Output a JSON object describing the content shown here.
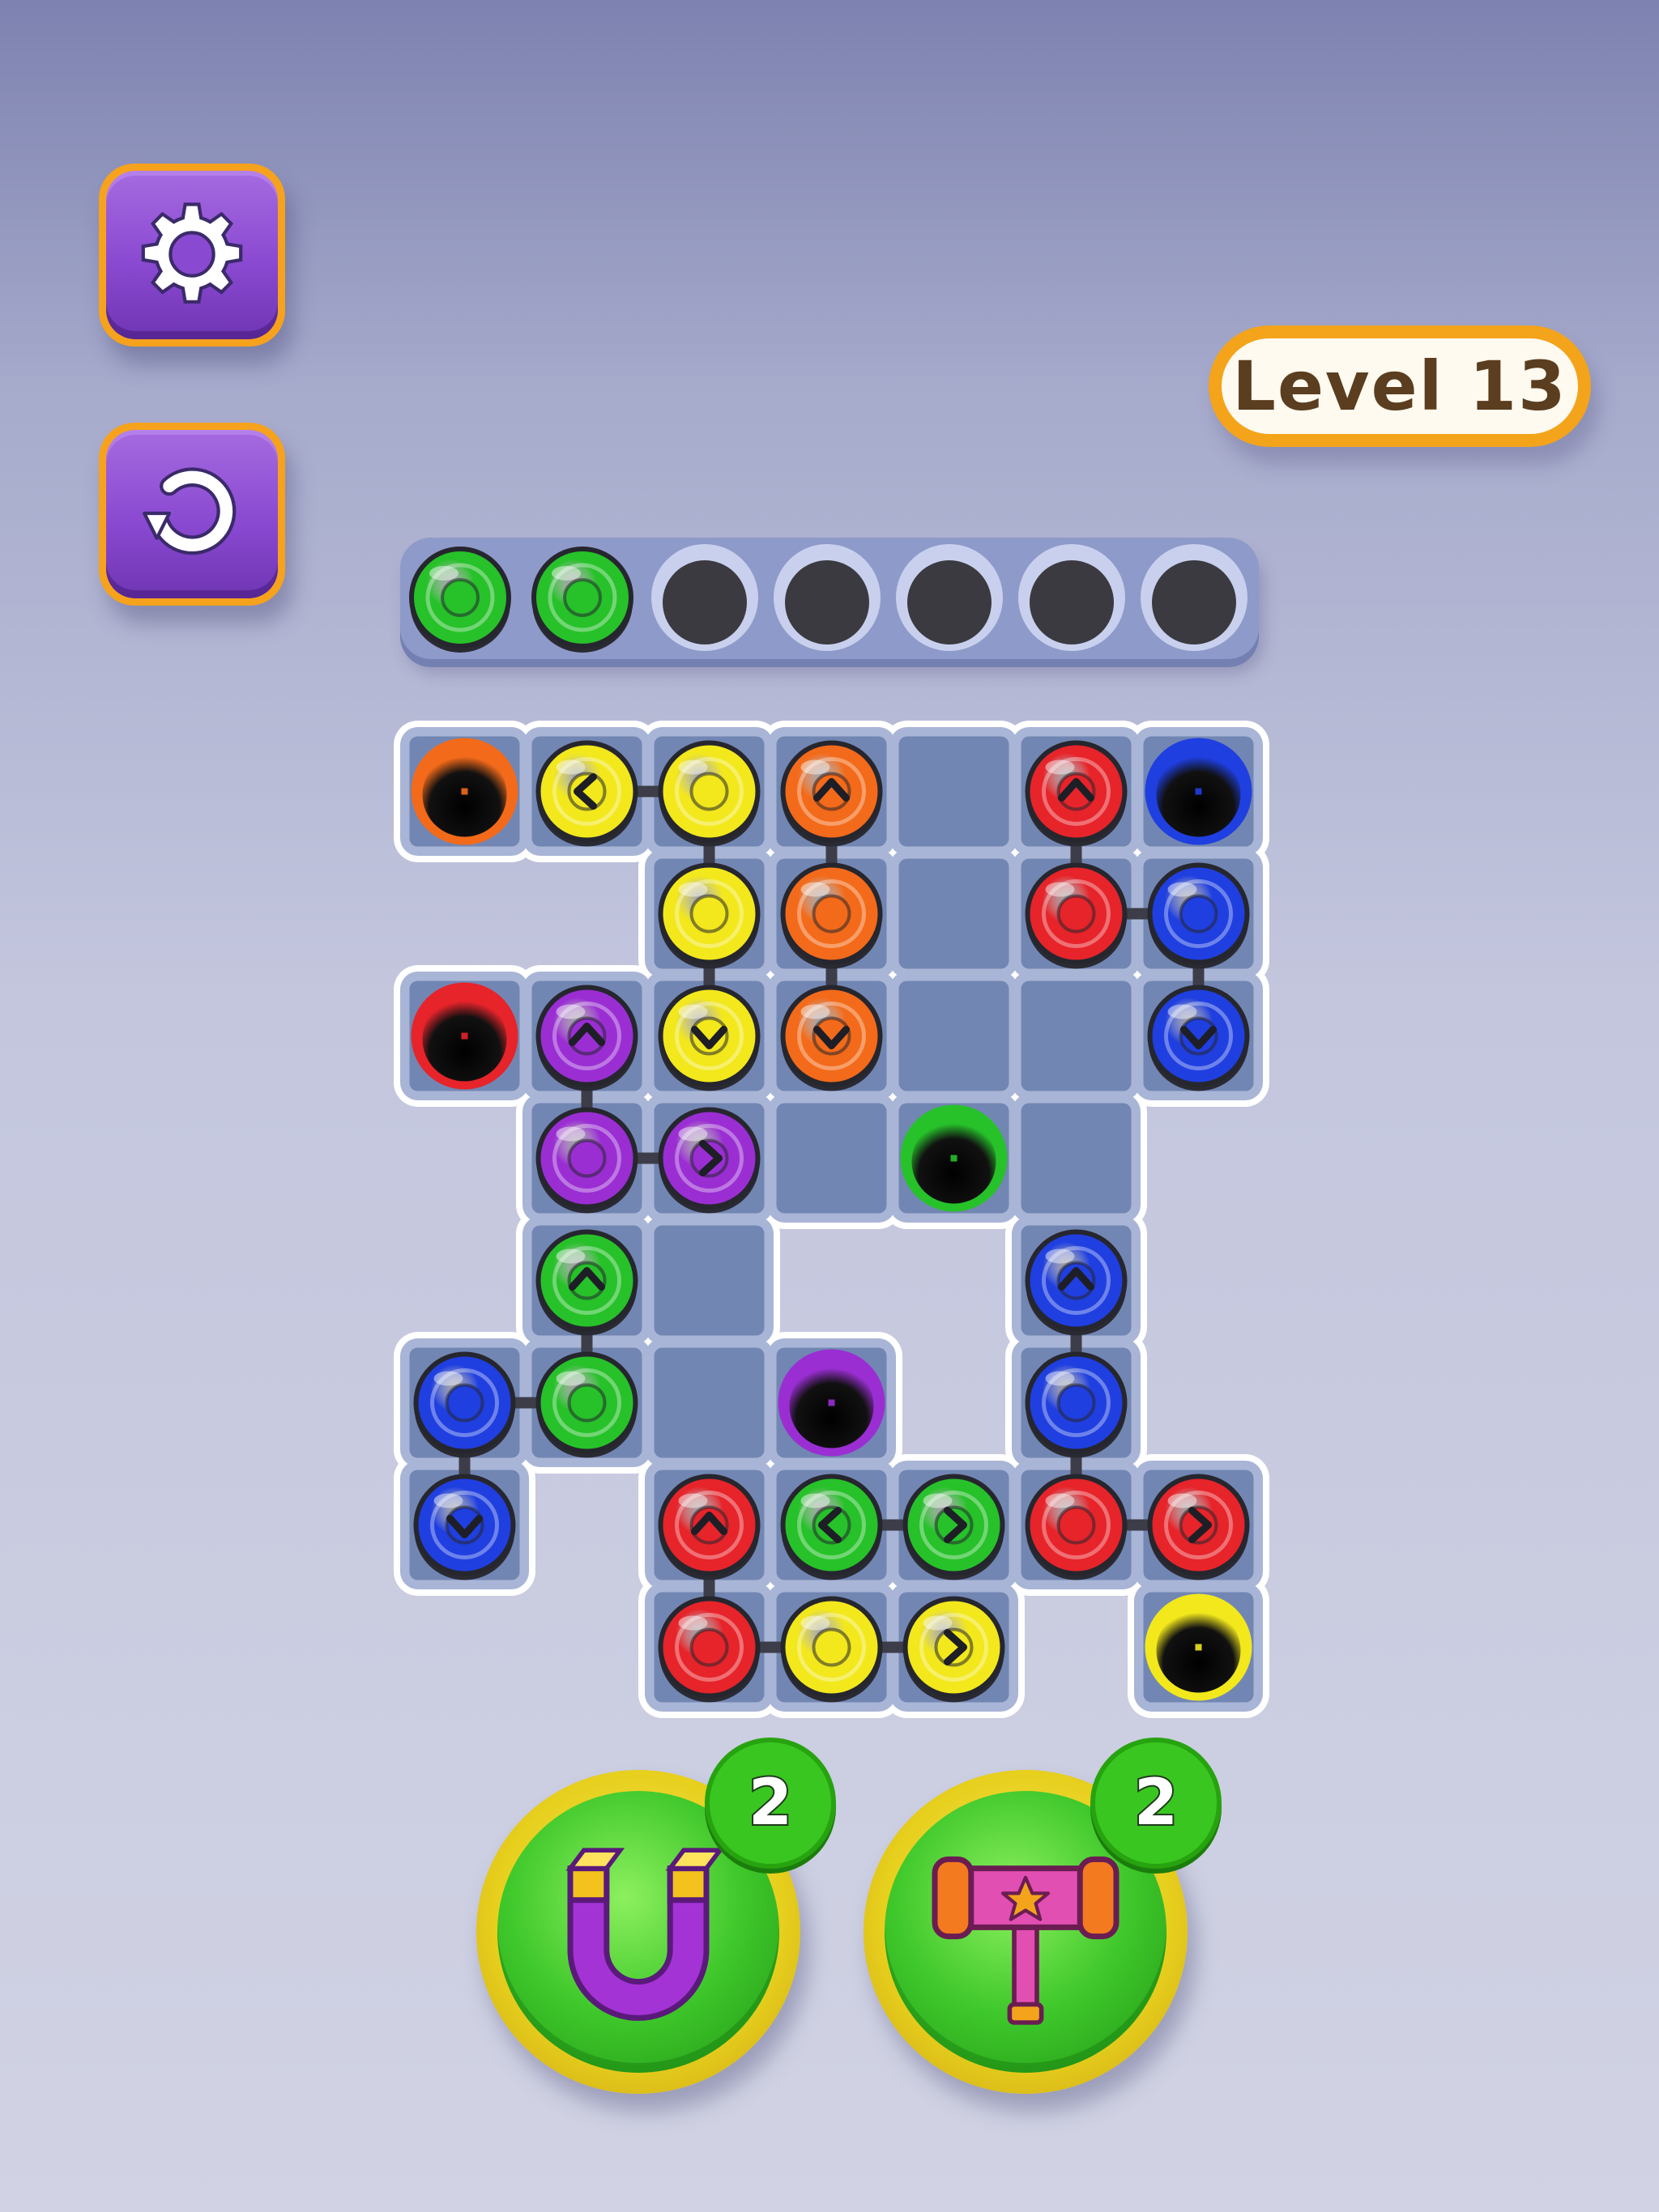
{
  "level": {
    "label": "Level 13"
  },
  "colors": {
    "red": "#e6242a",
    "blue": "#1f3fe0",
    "green": "#27c12a",
    "yellow": "#f2e81c",
    "orange": "#f36a1a",
    "purple": "#9a2ed3",
    "board": "#a9b5d6",
    "tile": "#7286b3",
    "accent": "#f4a41b"
  },
  "tray": {
    "slots": [
      "green",
      "green",
      "empty",
      "empty",
      "empty",
      "empty",
      "empty"
    ]
  },
  "board": {
    "rows": 8,
    "cols": 7,
    "cells": [
      [
        0,
        0
      ],
      [
        1,
        0
      ],
      [
        2,
        0
      ],
      [
        3,
        0
      ],
      [
        4,
        0
      ],
      [
        5,
        0
      ],
      [
        6,
        0
      ],
      [
        2,
        1
      ],
      [
        3,
        1
      ],
      [
        4,
        1
      ],
      [
        5,
        1
      ],
      [
        6,
        1
      ],
      [
        0,
        2
      ],
      [
        1,
        2
      ],
      [
        2,
        2
      ],
      [
        3,
        2
      ],
      [
        4,
        2
      ],
      [
        5,
        2
      ],
      [
        6,
        2
      ],
      [
        1,
        3
      ],
      [
        2,
        3
      ],
      [
        3,
        3
      ],
      [
        4,
        3
      ],
      [
        5,
        3
      ],
      [
        1,
        4
      ],
      [
        2,
        4
      ],
      [
        5,
        4
      ],
      [
        0,
        5
      ],
      [
        1,
        5
      ],
      [
        2,
        5
      ],
      [
        3,
        5
      ],
      [
        5,
        5
      ],
      [
        0,
        6
      ],
      [
        2,
        6
      ],
      [
        3,
        6
      ],
      [
        4,
        6
      ],
      [
        5,
        6
      ],
      [
        6,
        6
      ],
      [
        2,
        7
      ],
      [
        3,
        7
      ],
      [
        4,
        7
      ],
      [
        6,
        7
      ]
    ],
    "holes": [
      {
        "col": 0,
        "row": 0,
        "color": "orange"
      },
      {
        "col": 6,
        "row": 0,
        "color": "blue"
      },
      {
        "col": 0,
        "row": 2,
        "color": "red"
      },
      {
        "col": 4,
        "row": 3,
        "color": "green"
      },
      {
        "col": 3,
        "row": 5,
        "color": "purple"
      },
      {
        "col": 6,
        "row": 7,
        "color": "yellow"
      }
    ],
    "balls": [
      {
        "col": 1,
        "row": 0,
        "color": "yellow",
        "arrow": "left"
      },
      {
        "col": 2,
        "row": 0,
        "color": "yellow"
      },
      {
        "col": 2,
        "row": 1,
        "color": "yellow"
      },
      {
        "col": 2,
        "row": 2,
        "color": "yellow",
        "arrow": "down"
      },
      {
        "col": 3,
        "row": 0,
        "color": "orange",
        "arrow": "up"
      },
      {
        "col": 3,
        "row": 1,
        "color": "orange"
      },
      {
        "col": 3,
        "row": 2,
        "color": "orange",
        "arrow": "down"
      },
      {
        "col": 5,
        "row": 0,
        "color": "red",
        "arrow": "up"
      },
      {
        "col": 5,
        "row": 1,
        "color": "red"
      },
      {
        "col": 6,
        "row": 1,
        "color": "blue"
      },
      {
        "col": 6,
        "row": 2,
        "color": "blue",
        "arrow": "down"
      },
      {
        "col": 1,
        "row": 2,
        "color": "purple",
        "arrow": "up"
      },
      {
        "col": 1,
        "row": 3,
        "color": "purple"
      },
      {
        "col": 2,
        "row": 3,
        "color": "purple",
        "arrow": "right"
      },
      {
        "col": 1,
        "row": 4,
        "color": "green",
        "arrow": "up"
      },
      {
        "col": 1,
        "row": 5,
        "color": "green"
      },
      {
        "col": 0,
        "row": 5,
        "color": "blue"
      },
      {
        "col": 0,
        "row": 6,
        "color": "blue",
        "arrow": "down"
      },
      {
        "col": 5,
        "row": 4,
        "color": "blue",
        "arrow": "up"
      },
      {
        "col": 5,
        "row": 5,
        "color": "blue"
      },
      {
        "col": 2,
        "row": 6,
        "color": "red",
        "arrow": "up"
      },
      {
        "col": 2,
        "row": 7,
        "color": "red"
      },
      {
        "col": 3,
        "row": 6,
        "color": "green",
        "arrow": "left"
      },
      {
        "col": 4,
        "row": 6,
        "color": "green",
        "arrow": "right"
      },
      {
        "col": 5,
        "row": 6,
        "color": "red"
      },
      {
        "col": 6,
        "row": 6,
        "color": "red",
        "arrow": "right"
      },
      {
        "col": 3,
        "row": 7,
        "color": "yellow"
      },
      {
        "col": 4,
        "row": 7,
        "color": "yellow",
        "arrow": "right"
      }
    ],
    "links": [
      [
        [
          1,
          0
        ],
        [
          2,
          0
        ]
      ],
      [
        [
          2,
          0
        ],
        [
          2,
          1
        ]
      ],
      [
        [
          2,
          1
        ],
        [
          2,
          2
        ]
      ],
      [
        [
          3,
          0
        ],
        [
          3,
          1
        ]
      ],
      [
        [
          3,
          1
        ],
        [
          3,
          2
        ]
      ],
      [
        [
          5,
          0
        ],
        [
          5,
          1
        ]
      ],
      [
        [
          5,
          1
        ],
        [
          6,
          1
        ]
      ],
      [
        [
          6,
          1
        ],
        [
          6,
          2
        ]
      ],
      [
        [
          1,
          2
        ],
        [
          1,
          3
        ]
      ],
      [
        [
          1,
          3
        ],
        [
          2,
          3
        ]
      ],
      [
        [
          1,
          4
        ],
        [
          1,
          5
        ]
      ],
      [
        [
          0,
          5
        ],
        [
          1,
          5
        ]
      ],
      [
        [
          0,
          5
        ],
        [
          0,
          6
        ]
      ],
      [
        [
          5,
          4
        ],
        [
          5,
          5
        ]
      ],
      [
        [
          5,
          5
        ],
        [
          5,
          6
        ]
      ],
      [
        [
          5,
          6
        ],
        [
          6,
          6
        ]
      ],
      [
        [
          2,
          6
        ],
        [
          2,
          7
        ]
      ],
      [
        [
          2,
          7
        ],
        [
          3,
          7
        ]
      ],
      [
        [
          3,
          7
        ],
        [
          4,
          7
        ]
      ],
      [
        [
          3,
          6
        ],
        [
          4,
          6
        ]
      ]
    ]
  },
  "boosters": {
    "magnet": {
      "icon": "magnet-icon",
      "count": "2"
    },
    "hammer": {
      "icon": "hammer-icon",
      "count": "2"
    }
  }
}
